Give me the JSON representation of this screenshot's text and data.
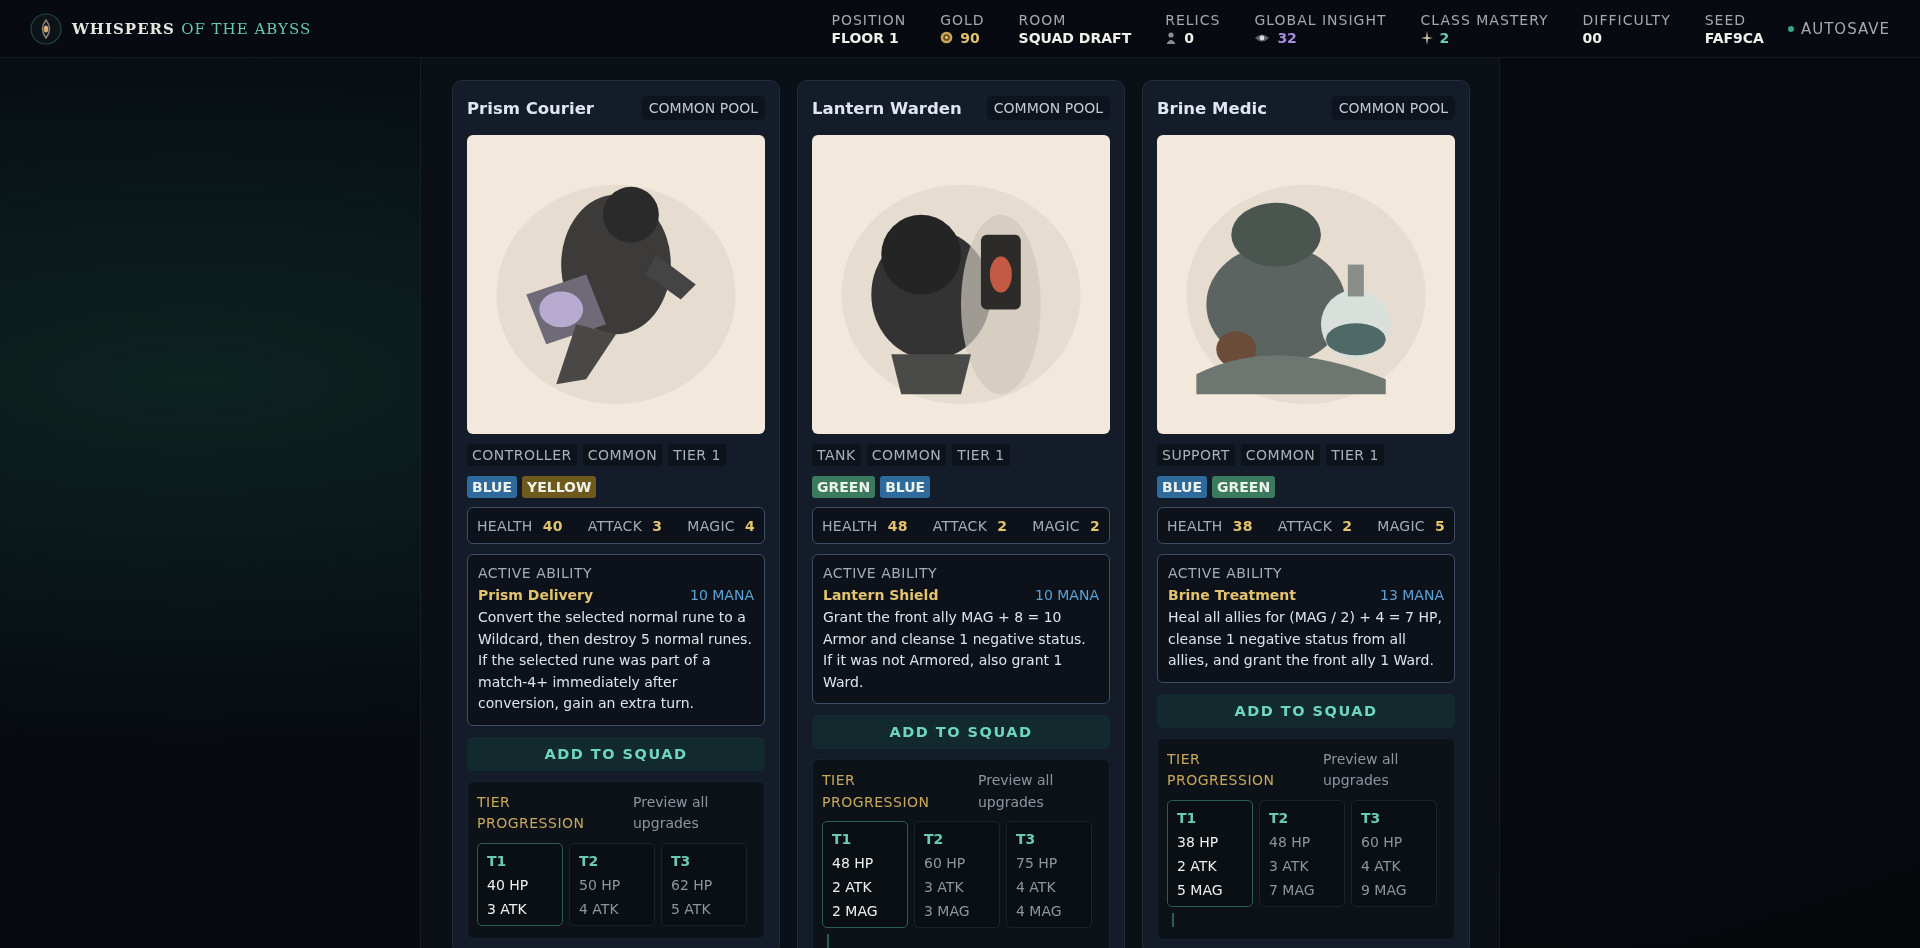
{
  "header": {
    "title_main": "WHISPERS",
    "title_accent": "OF THE ABYSS",
    "stats": [
      {
        "label": "POSITION",
        "value": "FLOOR 1",
        "kind": "plain"
      },
      {
        "label": "GOLD",
        "value": "90",
        "kind": "gold"
      },
      {
        "label": "ROOM",
        "value": "SQUAD DRAFT",
        "kind": "plain"
      },
      {
        "label": "RELICS",
        "value": "0",
        "kind": "relic"
      },
      {
        "label": "GLOBAL INSIGHT",
        "value": "32",
        "kind": "insight"
      },
      {
        "label": "CLASS MASTERY",
        "value": "2",
        "kind": "mastery"
      },
      {
        "label": "DIFFICULTY",
        "value": "00",
        "kind": "plain"
      },
      {
        "label": "SEED",
        "value": "FAF9CA",
        "kind": "plain"
      }
    ],
    "autosave": "AUTOSAVE"
  },
  "cards": [
    {
      "name": "Prism Courier",
      "pool": "COMMON POOL",
      "image": {
        "kind": "picture"
      },
      "tags": [
        "CONTROLLER",
        "COMMON",
        "TIER 1"
      ],
      "colors": [
        {
          "label": "BLUE",
          "color": "#2e6a9c"
        },
        {
          "label": "YELLOW",
          "color": "#6f5a1e"
        }
      ],
      "stats": [
        {
          "label": "HEALTH",
          "value": "40"
        },
        {
          "label": "ATTACK",
          "value": "3"
        },
        {
          "label": "MAGIC",
          "value": "4"
        }
      ],
      "ability": {
        "heading": "ACTIVE ABILITY",
        "name": "Prism Delivery",
        "cost": "10 MANA",
        "text": "Convert the selected normal rune to a Wildcard, then destroy 5 normal runes. If the selected rune was part of a match-4+ immediately after conversion, gain an extra turn."
      },
      "button": "ADD TO SQUAD",
      "progression": {
        "title": "TIER PROGRESSION",
        "link": "Preview all upgrades",
        "tiers": [
          {
            "label": "T1",
            "selected": true,
            "lines": [
              "40 HP",
              "3 ATK"
            ]
          },
          {
            "label": "T2",
            "selected": false,
            "lines": [
              "50 HP",
              "4 ATK"
            ]
          },
          {
            "label": "T3",
            "selected": false,
            "lines": [
              "62 HP",
              "5 ATK"
            ]
          }
        ]
      }
    },
    {
      "name": "Lantern Warden",
      "pool": "COMMON POOL",
      "image": {
        "kind": "picture"
      },
      "tags": [
        "TANK",
        "COMMON",
        "TIER 1"
      ],
      "colors": [
        {
          "label": "GREEN",
          "color": "#3a7a5e"
        },
        {
          "label": "BLUE",
          "color": "#2e6a9c"
        }
      ],
      "stats": [
        {
          "label": "HEALTH",
          "value": "48"
        },
        {
          "label": "ATTACK",
          "value": "2"
        },
        {
          "label": "MAGIC",
          "value": "2"
        }
      ],
      "ability": {
        "heading": "ACTIVE ABILITY",
        "name": "Lantern Shield",
        "cost": "10 MANA",
        "text": "Grant the front ally MAG + 8 = 10 Armor and cleanse 1 negative status. If it was not Armored, also grant 1 Ward."
      },
      "button": "ADD TO SQUAD",
      "progression": {
        "title": "TIER PROGRESSION",
        "link": "Preview all upgrades",
        "tiers": [
          {
            "label": "T1",
            "selected": true,
            "lines": [
              "48 HP",
              "2 ATK",
              "2 MAG"
            ]
          },
          {
            "label": "T2",
            "selected": false,
            "lines": [
              "60 HP",
              "3 ATK",
              "3 MAG"
            ]
          },
          {
            "label": "T3",
            "selected": false,
            "lines": [
              "75 HP",
              "4 ATK",
              "4 MAG"
            ]
          }
        ]
      }
    },
    {
      "name": "Brine Medic",
      "pool": "COMMON POOL",
      "image": {
        "kind": "picture"
      },
      "tags": [
        "SUPPORT",
        "COMMON",
        "TIER 1"
      ],
      "colors": [
        {
          "label": "BLUE",
          "color": "#2e6a9c"
        },
        {
          "label": "GREEN",
          "color": "#3a7a5e"
        }
      ],
      "stats": [
        {
          "label": "HEALTH",
          "value": "38"
        },
        {
          "label": "ATTACK",
          "value": "2"
        },
        {
          "label": "MAGIC",
          "value": "5"
        }
      ],
      "ability": {
        "heading": "ACTIVE ABILITY",
        "name": "Brine Treatment",
        "cost": "13 MANA",
        "text": "Heal all allies for (MAG / 2) + 4 = 7 HP, cleanse 1 negative status from all allies, and grant the front ally 1 Ward."
      },
      "button": "ADD TO SQUAD",
      "progression": {
        "title": "TIER PROGRESSION",
        "link": "Preview all upgrades",
        "tiers": [
          {
            "label": "T1",
            "selected": true,
            "lines": [
              "38 HP",
              "2 ATK",
              "5 MAG"
            ]
          },
          {
            "label": "T2",
            "selected": false,
            "lines": [
              "48 HP",
              "3 ATK",
              "7 MAG"
            ]
          },
          {
            "label": "T3",
            "selected": false,
            "lines": [
              "60 HP",
              "4 ATK",
              "9 MAG"
            ]
          }
        ]
      }
    }
  ]
}
